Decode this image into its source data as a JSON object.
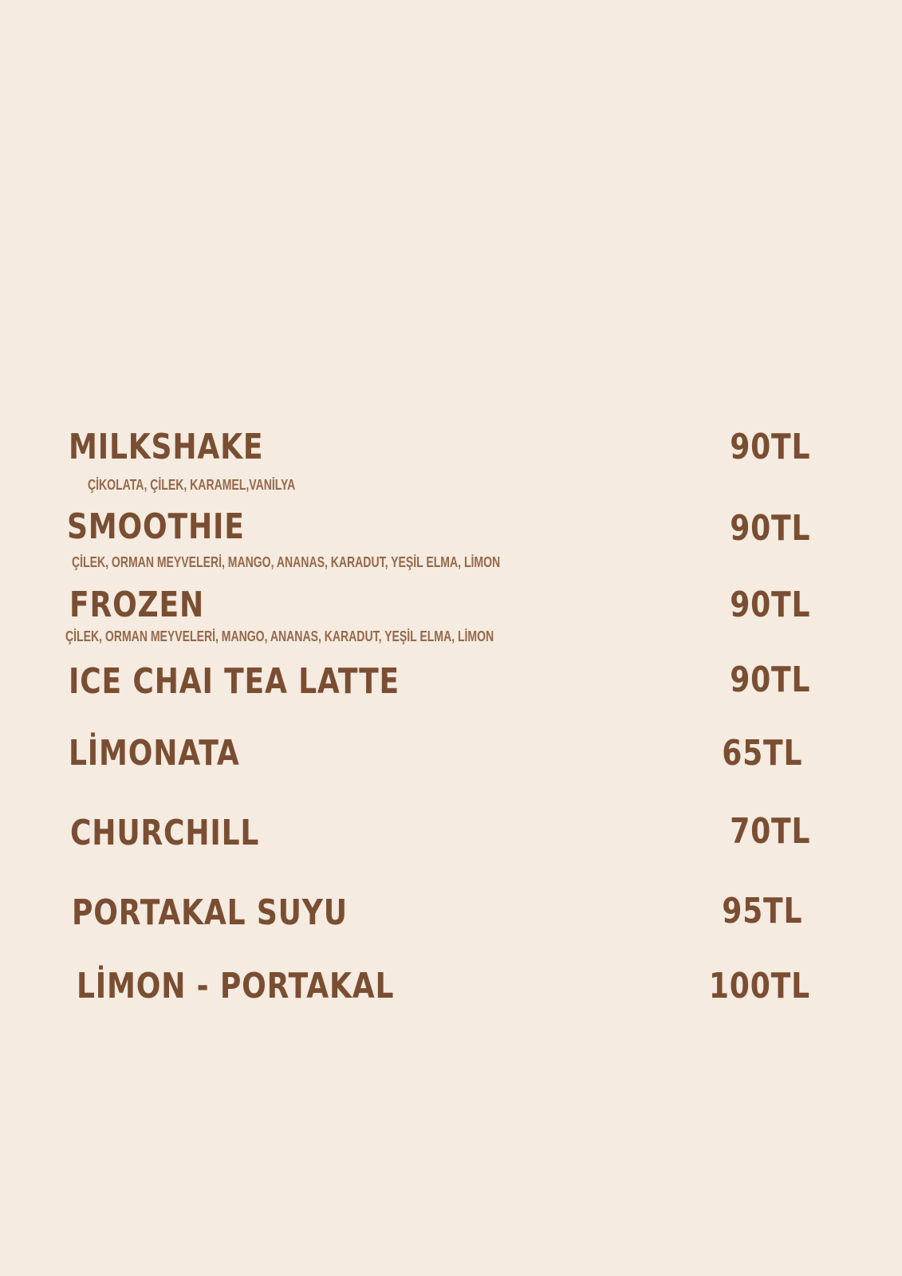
{
  "menu": {
    "items": [
      {
        "name": "MILKSHAKE",
        "description": "ÇİKOLATA, ÇİLEK, KARAMEL,VANİLYA",
        "price": "90TL"
      },
      {
        "name": "SMOOTHIE",
        "description": "ÇİLEK, ORMAN MEYVELERİ, MANGO, ANANAS, KARADUT, YEŞİL ELMA, LİMON",
        "price": "90TL"
      },
      {
        "name": "FROZEN",
        "description": "ÇİLEK, ORMAN MEYVELERİ, MANGO, ANANAS, KARADUT, YEŞİL ELMA, LİMON",
        "price": "90TL"
      },
      {
        "name": "ICE CHAI TEA LATTE",
        "price": "90TL"
      },
      {
        "name": "LİMONATA",
        "price": "65TL"
      },
      {
        "name": "CHURCHILL",
        "price": "70TL"
      },
      {
        "name": "PORTAKAL SUYU",
        "price": "95TL"
      },
      {
        "name": "LİMON - PORTAKAL",
        "price": "100TL"
      }
    ]
  },
  "colors": {
    "background": "#f5ebe0",
    "text": "#7a4e32",
    "description": "#96684a"
  }
}
